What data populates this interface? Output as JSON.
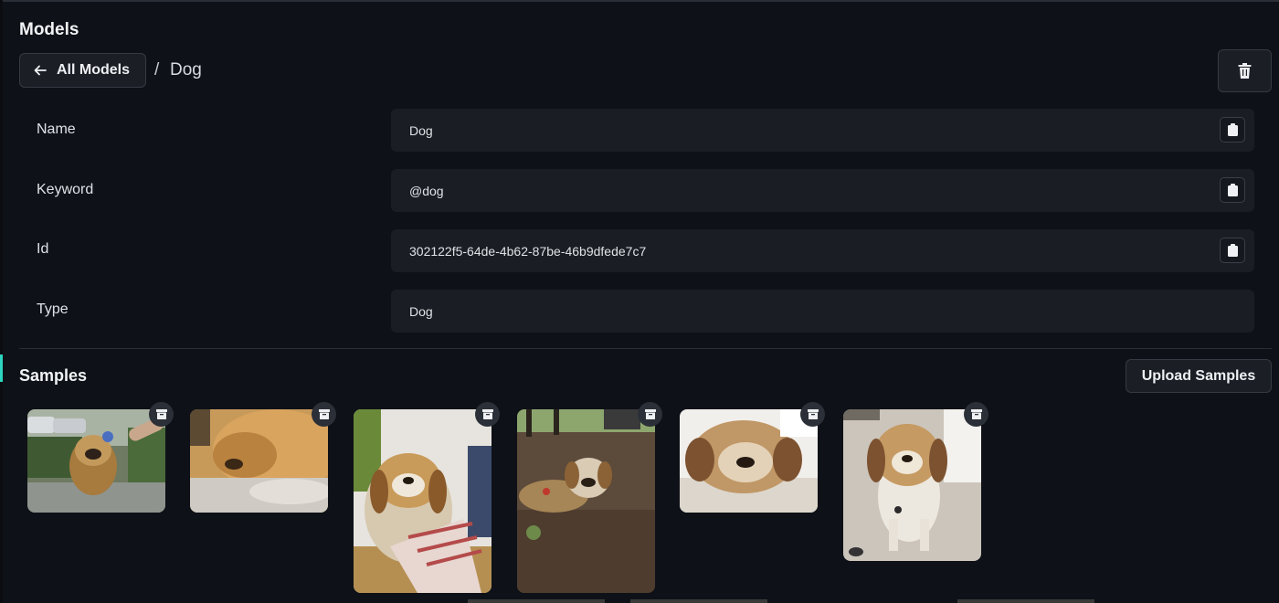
{
  "header": {
    "title": "Models",
    "back_label": "All Models",
    "separator": "/",
    "current": "Dog"
  },
  "fields": [
    {
      "label": "Name",
      "value": "Dog",
      "copyable": true
    },
    {
      "label": "Keyword",
      "value": "@dog",
      "copyable": true
    },
    {
      "label": "Id",
      "value": "302122f5-64de-4b62-87be-46b9dfede7c7",
      "copyable": true
    },
    {
      "label": "Type",
      "value": "Dog",
      "copyable": false
    }
  ],
  "samples": {
    "title": "Samples",
    "upload_label": "Upload Samples",
    "count": 6
  },
  "colors": {
    "background": "#0e1117",
    "field_bg": "#1a1d23",
    "border": "#353a44",
    "accent": "#2dd4bf"
  },
  "icons": [
    "arrow-left-icon",
    "trash-icon",
    "clipboard-icon",
    "archive-icon"
  ]
}
